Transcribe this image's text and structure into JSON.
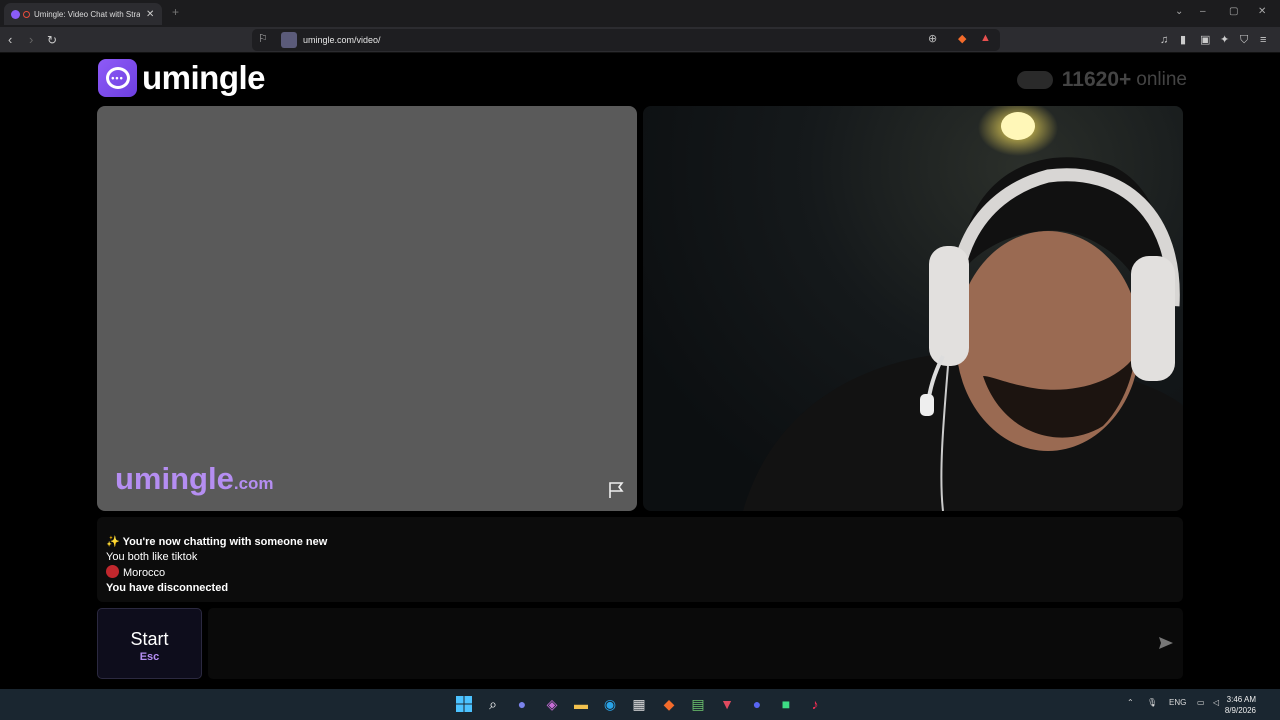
{
  "browser": {
    "tab_title": "Umingle: Video Chat with Strangers",
    "new_tab_glyph": "+",
    "url": "umingle.com/video/"
  },
  "header": {
    "logo_text": "umingle",
    "online_count": "11620+",
    "online_label": "online"
  },
  "left_video": {
    "watermark_main": "umingle",
    "watermark_suffix": ".com",
    "report_icon": "flag-icon"
  },
  "chat": {
    "line1_icon": "✨",
    "line1_text": "You're now chatting with someone new",
    "line2_text": "You both like tiktok",
    "line3_country": "Morocco",
    "line4_text": "You have disconnected"
  },
  "controls": {
    "start_label": "Start",
    "start_key": "Esc",
    "message_placeholder": "",
    "send_icon": "send-icon"
  },
  "taskbar": {
    "lang": "ENG",
    "time": "3:46 AM",
    "date": "8/9/2026"
  },
  "colors": {
    "brand_purple": "#8e5bf7",
    "watermark_purple": "#b58ef2",
    "morocco_red": "#c1272d"
  }
}
